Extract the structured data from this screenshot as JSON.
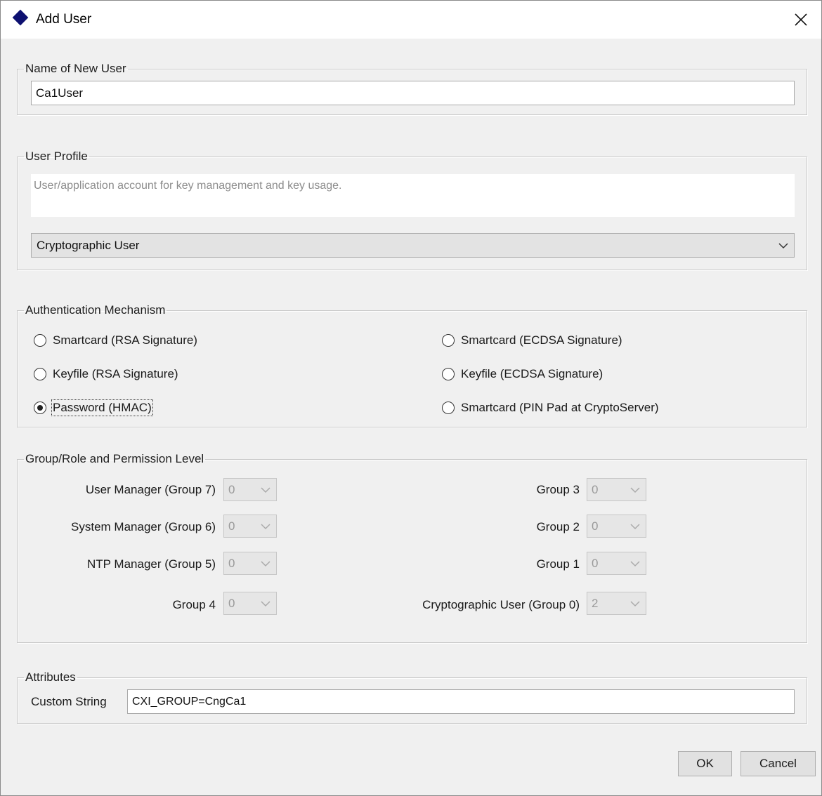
{
  "window": {
    "title": "Add User"
  },
  "name_section": {
    "legend": "Name of New User",
    "value": "Ca1User"
  },
  "profile_section": {
    "legend": "User Profile",
    "description": "User/application account for key management and key usage.",
    "selected": "Cryptographic User"
  },
  "auth_section": {
    "legend": "Authentication Mechanism",
    "options": [
      "Smartcard (RSA Signature)",
      "Keyfile (RSA Signature)",
      "Password (HMAC)",
      "Smartcard (ECDSA Signature)",
      "Keyfile (ECDSA Signature)",
      "Smartcard (PIN Pad at CryptoServer)"
    ],
    "selected": "Password (HMAC)"
  },
  "group_section": {
    "legend": "Group/Role and Permission Level",
    "left": [
      {
        "label": "User Manager (Group 7)",
        "value": "0"
      },
      {
        "label": "System Manager (Group 6)",
        "value": "0"
      },
      {
        "label": "NTP Manager (Group 5)",
        "value": "0"
      },
      {
        "label": "Group 4",
        "value": "0"
      }
    ],
    "right": [
      {
        "label": "Group 3",
        "value": "0"
      },
      {
        "label": "Group 2",
        "value": "0"
      },
      {
        "label": "Group 1",
        "value": "0"
      },
      {
        "label": "Cryptographic User (Group 0)",
        "value": "2"
      }
    ]
  },
  "attributes_section": {
    "legend": "Attributes",
    "custom_label": "Custom String",
    "custom_value": "CXI_GROUP=CngCa1"
  },
  "buttons": {
    "ok": "OK",
    "cancel": "Cancel"
  },
  "icons": {
    "app": "diamond-icon",
    "close": "close-icon",
    "dropdown": "chevron-down-icon"
  },
  "colors": {
    "app_icon": "#0d1070",
    "dialog_bg": "#f0f0f0"
  }
}
